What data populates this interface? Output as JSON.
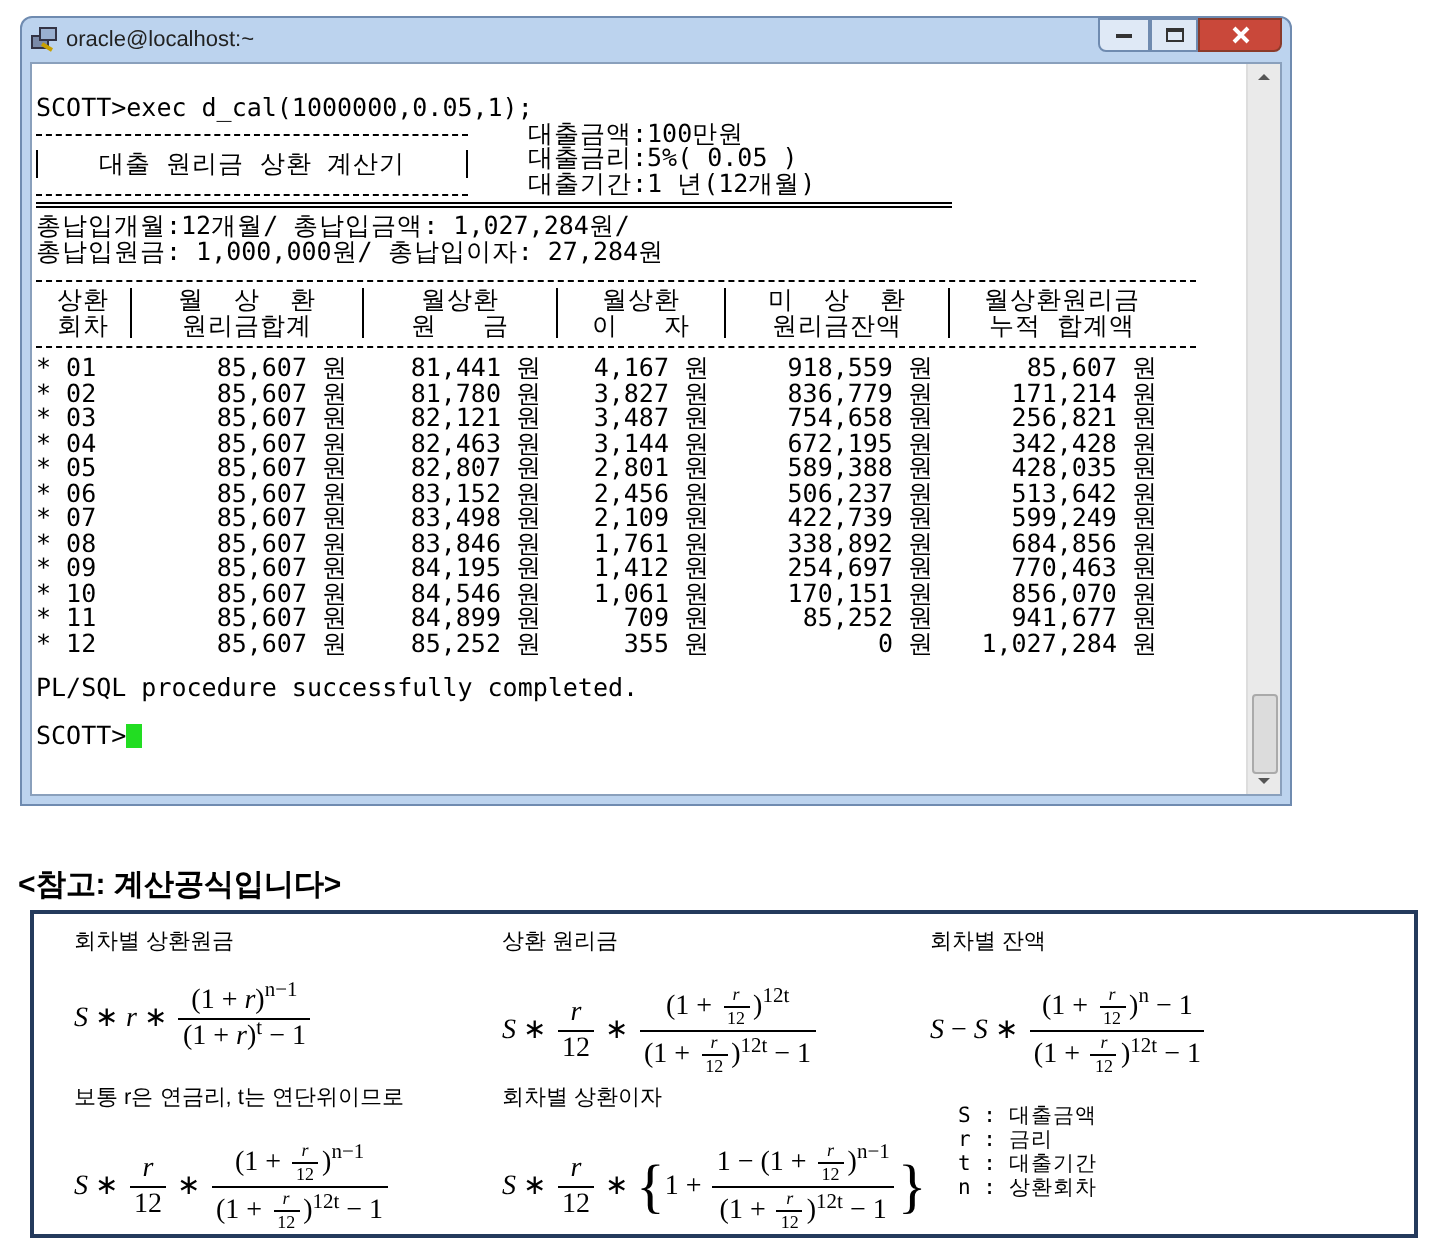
{
  "window": {
    "title": "oracle@localhost:~"
  },
  "terminal": {
    "command": "SCOTT>exec d_cal(1000000,0.05,1);",
    "banner_title": "대출 원리금 상환 계산기",
    "loan_info": [
      "대출금액:100만원",
      "대출금리:5%( 0.05 )",
      "대출기간:1 년(12개월)"
    ],
    "summary": [
      "총납입개월:12개월/ 총납입금액: 1,027,284원/",
      "총납입원금: 1,000,000원/ 총납입이자: 27,284원"
    ],
    "header_rows": [
      [
        "상환",
        "월  상  환",
        "월상환",
        "월상환",
        "미  상  환",
        "월상환원리금"
      ],
      [
        "회차",
        "원리금합계",
        "원   금",
        "이   자",
        "원리금잔액",
        "누적 합계액"
      ]
    ],
    "rows": [
      [
        "* 01",
        "85,607 원",
        "81,441 원",
        "4,167 원",
        "918,559 원",
        "85,607 원"
      ],
      [
        "* 02",
        "85,607 원",
        "81,780 원",
        "3,827 원",
        "836,779 원",
        "171,214 원"
      ],
      [
        "* 03",
        "85,607 원",
        "82,121 원",
        "3,487 원",
        "754,658 원",
        "256,821 원"
      ],
      [
        "* 04",
        "85,607 원",
        "82,463 원",
        "3,144 원",
        "672,195 원",
        "342,428 원"
      ],
      [
        "* 05",
        "85,607 원",
        "82,807 원",
        "2,801 원",
        "589,388 원",
        "428,035 원"
      ],
      [
        "* 06",
        "85,607 원",
        "83,152 원",
        "2,456 원",
        "506,237 원",
        "513,642 원"
      ],
      [
        "* 07",
        "85,607 원",
        "83,498 원",
        "2,109 원",
        "422,739 원",
        "599,249 원"
      ],
      [
        "* 08",
        "85,607 원",
        "83,846 원",
        "1,761 원",
        "338,892 원",
        "684,856 원"
      ],
      [
        "* 09",
        "85,607 원",
        "84,195 원",
        "1,412 원",
        "254,697 원",
        "770,463 원"
      ],
      [
        "* 10",
        "85,607 원",
        "84,546 원",
        "1,061 원",
        "170,151 원",
        "856,070 원"
      ],
      [
        "* 11",
        "85,607 원",
        "84,899 원",
        "709 원",
        "85,252 원",
        "941,677 원"
      ],
      [
        "* 12",
        "85,607 원",
        "85,252 원",
        "355 원",
        "0 원",
        "1,027,284 원"
      ]
    ],
    "message": "PL/SQL procedure successfully completed.",
    "prompt": "SCOTT>"
  },
  "reference": {
    "heading": "<참고: 계산공식입니다>",
    "formulas": [
      {
        "label": "회차별 상환원금",
        "expr": [
          {
            "kind": "text",
            "text": "*S* ∗ *r* ∗ "
          },
          {
            "kind": "frac",
            "num": [
              {
                "kind": "text",
                "text": "(1 + *r*)$^{n−1}$"
              }
            ],
            "den": [
              {
                "kind": "text",
                "text": "(1 + *r*)$^{t}$ − 1"
              }
            ]
          }
        ]
      },
      {
        "label": "상환 원리금",
        "expr": [
          {
            "kind": "text",
            "text": "*S* ∗ "
          },
          {
            "kind": "frac",
            "num": [
              {
                "kind": "text",
                "text": "*r*"
              }
            ],
            "den": [
              {
                "kind": "text",
                "text": "12"
              }
            ]
          },
          {
            "kind": "text",
            "text": " ∗ "
          },
          {
            "kind": "frac",
            "num": [
              {
                "kind": "text",
                "text": "(1 + "
              },
              {
                "kind": "frac",
                "num": [
                  {
                    "kind": "text",
                    "text": "*r*"
                  }
                ],
                "den": [
                  {
                    "kind": "text",
                    "text": "12"
                  }
                ]
              },
              {
                "kind": "text",
                "text": ")$^{12t}$"
              }
            ],
            "den": [
              {
                "kind": "text",
                "text": "(1 + "
              },
              {
                "kind": "frac",
                "num": [
                  {
                    "kind": "text",
                    "text": "*r*"
                  }
                ],
                "den": [
                  {
                    "kind": "text",
                    "text": "12"
                  }
                ]
              },
              {
                "kind": "text",
                "text": ")$^{12t}$ − 1"
              }
            ]
          }
        ]
      },
      {
        "label": "회차별 잔액",
        "expr": [
          {
            "kind": "text",
            "text": "*S* − *S* ∗ "
          },
          {
            "kind": "frac",
            "num": [
              {
                "kind": "text",
                "text": "(1 + "
              },
              {
                "kind": "frac",
                "num": [
                  {
                    "kind": "text",
                    "text": "*r*"
                  }
                ],
                "den": [
                  {
                    "kind": "text",
                    "text": "12"
                  }
                ]
              },
              {
                "kind": "text",
                "text": ")$^{n}$ − 1"
              }
            ],
            "den": [
              {
                "kind": "text",
                "text": "(1 + "
              },
              {
                "kind": "frac",
                "num": [
                  {
                    "kind": "text",
                    "text": "*r*"
                  }
                ],
                "den": [
                  {
                    "kind": "text",
                    "text": "12"
                  }
                ]
              },
              {
                "kind": "text",
                "text": ")$^{12t}$ − 1"
              }
            ]
          }
        ]
      },
      {
        "label": "보통 r은 연금리, t는 연단위이므로",
        "expr": [
          {
            "kind": "text",
            "text": "*S* ∗ "
          },
          {
            "kind": "frac",
            "num": [
              {
                "kind": "text",
                "text": "*r*"
              }
            ],
            "den": [
              {
                "kind": "text",
                "text": "12"
              }
            ]
          },
          {
            "kind": "text",
            "text": " ∗ "
          },
          {
            "kind": "frac",
            "num": [
              {
                "kind": "text",
                "text": "(1 + "
              },
              {
                "kind": "frac",
                "num": [
                  {
                    "kind": "text",
                    "text": "*r*"
                  }
                ],
                "den": [
                  {
                    "kind": "text",
                    "text": "12"
                  }
                ]
              },
              {
                "kind": "text",
                "text": ")$^{n−1}$"
              }
            ],
            "den": [
              {
                "kind": "text",
                "text": "(1 + "
              },
              {
                "kind": "frac",
                "num": [
                  {
                    "kind": "text",
                    "text": "*r*"
                  }
                ],
                "den": [
                  {
                    "kind": "text",
                    "text": "12"
                  }
                ]
              },
              {
                "kind": "text",
                "text": ")$^{12t}$ − 1"
              }
            ]
          }
        ]
      },
      {
        "label": "회차별 상환이자",
        "expr": [
          {
            "kind": "text",
            "text": "*S* ∗ "
          },
          {
            "kind": "frac",
            "num": [
              {
                "kind": "text",
                "text": "*r*"
              }
            ],
            "den": [
              {
                "kind": "text",
                "text": "12"
              }
            ]
          },
          {
            "kind": "text",
            "text": " ∗ "
          },
          {
            "kind": "brace",
            "open": "{",
            "close": "}",
            "body": [
              {
                "kind": "text",
                "text": "1 + "
              },
              {
                "kind": "frac",
                "num": [
                  {
                    "kind": "text",
                    "text": "1 − (1 + "
                  },
                  {
                    "kind": "frac",
                    "num": [
                      {
                        "kind": "text",
                        "text": "*r*"
                      }
                    ],
                    "den": [
                      {
                        "kind": "text",
                        "text": "12"
                      }
                    ]
                  },
                  {
                    "kind": "text",
                    "text": ")$^{n−1}$"
                  }
                ],
                "den": [
                  {
                    "kind": "text",
                    "text": "(1 + "
                  },
                  {
                    "kind": "frac",
                    "num": [
                      {
                        "kind": "text",
                        "text": "*r*"
                      }
                    ],
                    "den": [
                      {
                        "kind": "text",
                        "text": "12"
                      }
                    ]
                  },
                  {
                    "kind": "text",
                    "text": ")$^{12t}$ − 1"
                  }
                ]
              }
            ]
          }
        ]
      }
    ],
    "legend": [
      "S : 대출금액",
      "r : 금리",
      "t : 대출기간",
      "n : 상환회차"
    ]
  }
}
